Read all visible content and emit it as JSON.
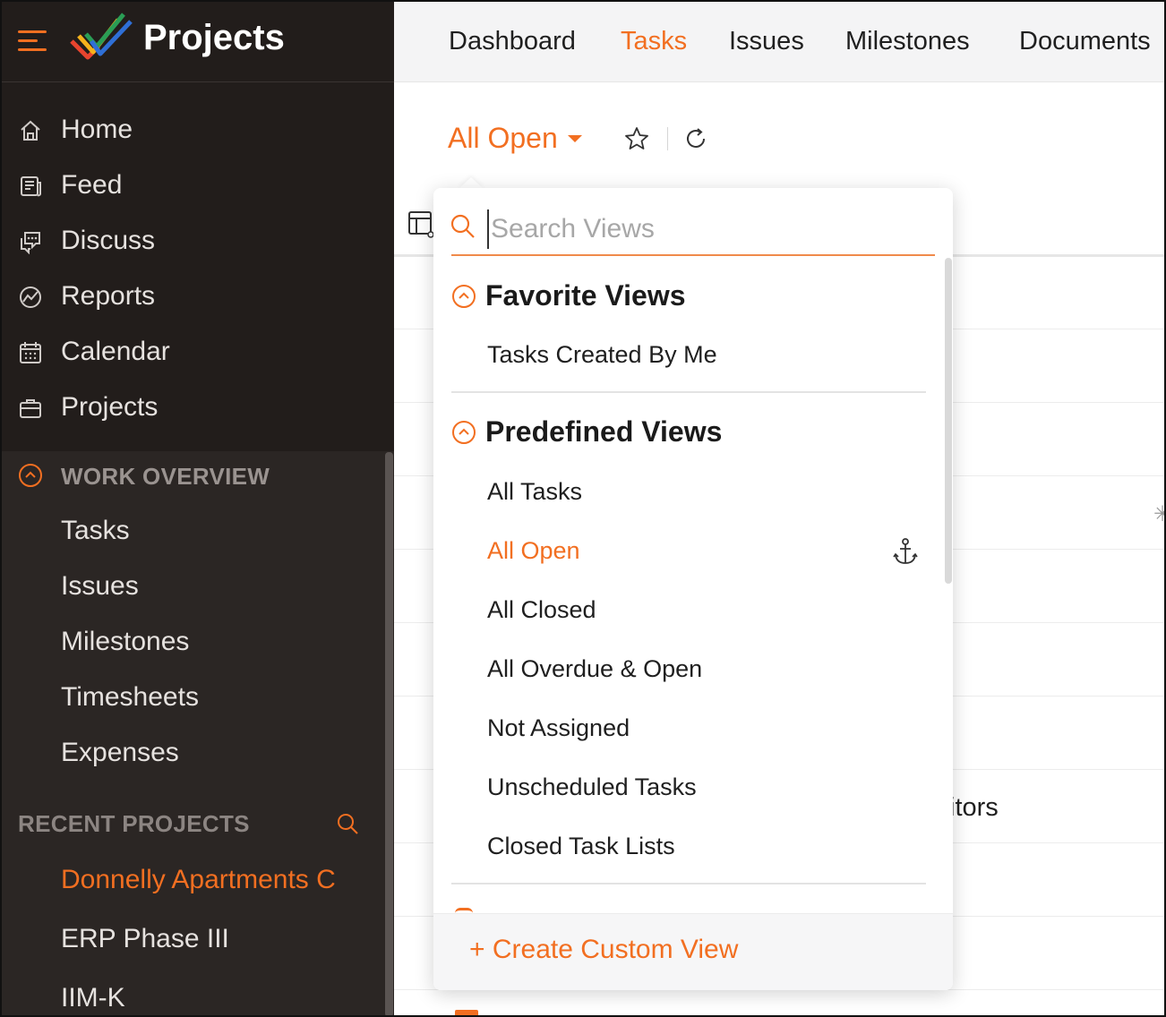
{
  "brand": {
    "title": "Projects",
    "menu_icon": "hamburger-icon",
    "logo_icon": "zoho-projects-logo"
  },
  "sidebar": {
    "items": [
      {
        "label": "Home",
        "icon": "home-icon"
      },
      {
        "label": "Feed",
        "icon": "feed-icon"
      },
      {
        "label": "Discuss",
        "icon": "discuss-icon"
      },
      {
        "label": "Reports",
        "icon": "reports-icon"
      },
      {
        "label": "Calendar",
        "icon": "calendar-icon"
      },
      {
        "label": "Projects",
        "icon": "briefcase-icon"
      }
    ],
    "work_overview": {
      "title": "WORK OVERVIEW",
      "items": [
        "Tasks",
        "Issues",
        "Milestones",
        "Timesheets",
        "Expenses"
      ]
    },
    "recent_projects": {
      "title": "RECENT PROJECTS",
      "items": [
        "Donnelly Apartments C",
        "ERP Phase III",
        "IIM-K"
      ],
      "active_index": 0
    }
  },
  "topnav": {
    "tabs": [
      "Dashboard",
      "Tasks",
      "Issues",
      "Milestones",
      "Documents"
    ],
    "active_tab": "Tasks"
  },
  "toolbar": {
    "view_label": "All Open"
  },
  "background": {
    "partial_text": "itors"
  },
  "dropdown": {
    "search_placeholder": "Search Views",
    "search_value": "",
    "favorite": {
      "title": "Favorite Views",
      "items": [
        "Tasks Created By Me"
      ]
    },
    "predefined": {
      "title": "Predefined Views",
      "items": [
        "All Tasks",
        "All Open",
        "All Closed",
        "All Overdue & Open",
        "Not Assigned",
        "Unscheduled Tasks",
        "Closed Task Lists"
      ],
      "active": "All Open"
    },
    "create_label": "+ Create Custom View"
  },
  "colors": {
    "accent": "#f26f21",
    "sidebar_bg": "#221d1b",
    "section_bg": "#2b2624",
    "topbar_bg": "#f4f4f5"
  }
}
